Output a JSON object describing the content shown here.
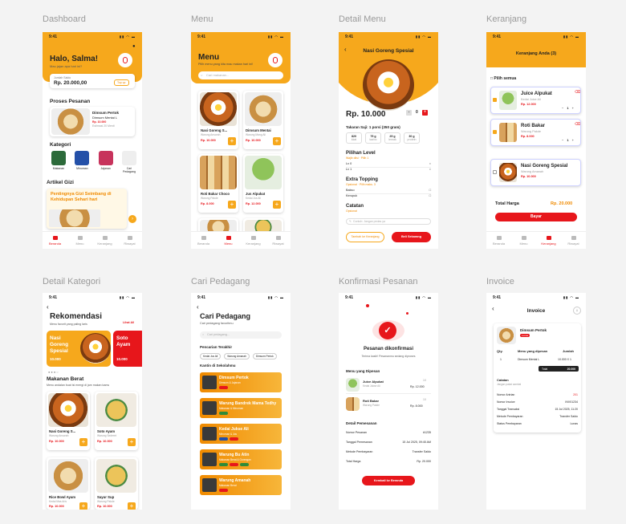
{
  "screens": {
    "dashboard": "Dashboard",
    "menu": "Menu",
    "detail_menu": "Detail Menu",
    "keranjang": "Keranjang",
    "detail_kategori": "Detail Kategori",
    "cari_pedagang": "Cari Pedagang",
    "konfirmasi": "Konfirmasi Pesanan",
    "invoice": "Invoice"
  },
  "time": "9:41",
  "nav": [
    "Beranda",
    "Menu",
    "Keranjang",
    "Riwayat"
  ],
  "dashboard": {
    "greeting": "Halo, Salma!",
    "sub": "Mau jajan apa hari ini?",
    "saldo_label": "Jumlah Saldo",
    "saldo": "Rp. 20.000,00",
    "topup": "Top up",
    "proses_title": "Proses Pesanan",
    "order_name": "Dimsum Pertok",
    "order_shop": "Dimsum Mentai L",
    "order_price": "Rp. 10.000",
    "order_eta": "Estimasi 20 Menit",
    "kategori_title": "Kategori",
    "kategori": [
      "Makanan",
      "Minuman",
      "Jajanan",
      "Cari Pedagang"
    ],
    "artikel_title": "Artikel Gizi",
    "artikel_text": "Pentingnya Gizi Seimbang di Kehidupan Sehari hari"
  },
  "menu": {
    "title": "Menu",
    "sub": "Pilih menu yang kita mau makan hari ini!",
    "search": "Cari makanan...",
    "items": [
      {
        "name": "Nasi Goreng S...",
        "shop": "Warung Ansorah",
        "price": "Rp. 10.000"
      },
      {
        "name": "Dimsum Mentai",
        "shop": "Warung Mang Ali",
        "price": "Rp. 10.000"
      },
      {
        "name": "Roti Bakar Choco",
        "shop": "Warung Pakde",
        "price": "Rp. 8.000"
      },
      {
        "name": "Jus Alpukat",
        "shop": "Kedai Jus Ali",
        "price": "Rp. 12.000"
      }
    ]
  },
  "detail": {
    "title": "Nasi Goreng Spesial",
    "price": "Rp. 10.000",
    "qty": "0",
    "gizi_title": "Takaran Saji: 1 porsi (350 gram)",
    "gizi": [
      {
        "v": "820",
        "u": "kkal"
      },
      {
        "v": "75 g",
        "u": "karbo"
      },
      {
        "v": "25 g",
        "u": "lemak"
      },
      {
        "v": "30 g",
        "u": "protein"
      }
    ],
    "level_title": "Pilihan Level",
    "level_sub": "Wajib diisi · Pilih 1",
    "levels": [
      "Lv 0",
      "Lv 1"
    ],
    "topping_title": "Extra Topping",
    "topping_sub": "Opsional · Pilih maks. 3",
    "toppings": [
      "Bakso",
      "Kerupuk"
    ],
    "catatan_title": "Catatan",
    "catatan_sub": "Opsional",
    "catatan_ph": "Contoh: Jangan pedas ya",
    "btn_cart": "Tambah ke Keranjang",
    "btn_buy": "Beli Sekarang"
  },
  "cart": {
    "title": "Keranjang Anda (3)",
    "pilih": "Pilih semua",
    "items": [
      {
        "name": "Juice Alpukat",
        "shop": "Kedai Juice Ali",
        "price": "Rp. 12.000",
        "qty": "1"
      },
      {
        "name": "Roti Bakar",
        "shop": "Warung Pakde",
        "price": "Rp. 8.000",
        "qty": "1"
      },
      {
        "name": "Nasi Goreng Spesial",
        "shop": "Warung Amanah",
        "price": "Rp. 10.000",
        "qty": "1"
      }
    ],
    "total_label": "Total Harga",
    "total": "Rp. 20.000",
    "pay": "Bayar"
  },
  "kategori": {
    "title": "Rekomendasi",
    "sub": "Menu favorit yang paling laris",
    "lihat": "Lihat All",
    "banner1": "Nasi Goreng Spesial",
    "banner1_price": "10.000",
    "banner2": "Soto Ayam",
    "banner2_price": "10.000",
    "section": "Makanan Berat",
    "section_sub": "Menu andalan buat isi energi di jam makan kamu",
    "items": [
      {
        "name": "Nasi Goreng S...",
        "shop": "Warung Ansorah",
        "price": "Rp. 10.000"
      },
      {
        "name": "Soto Ayam",
        "shop": "Warung Sederet",
        "price": "Rp. 10.000"
      },
      {
        "name": "Rice Bowl Ayam",
        "shop": "Kedai Mas Aris",
        "price": "Rp. 10.000"
      },
      {
        "name": "Sayur Sup",
        "shop": "Warung Pakde",
        "price": "Rp. 10.000"
      }
    ]
  },
  "cari": {
    "title": "Cari Pedagang",
    "sub": "Cari pedagang favoritmu",
    "search": "Cari pedagang...",
    "recent_title": "Pencarian Terakhir",
    "recent": [
      "Kedai Jus Ali",
      "Warung Amanah",
      "Dimsum Pertok"
    ],
    "kantin_title": "Kantin di Sekolahmu",
    "shops": [
      {
        "name": "Dimsum Pertok",
        "desc": "Dimsum & Jajanan"
      },
      {
        "name": "Warung Bandrek Mama Tedhy",
        "desc": "Makanan & Minuman"
      },
      {
        "name": "Kedai Jukse Ali",
        "desc": "Minuman & Jus"
      },
      {
        "name": "Warung Bu Atin",
        "desc": "Makanan Berat & Gorengan"
      },
      {
        "name": "Warung Amanah",
        "desc": "Makanan Berat"
      }
    ]
  },
  "konfirm": {
    "title": "Pesanan dikonfirmasi",
    "sub": "Terima kasih! Pesananmu sedang diproses",
    "dipesan_title": "Menu yang Dipesan",
    "items": [
      {
        "name": "Juice Alpukat",
        "shop": "Kedai Jukse Ali",
        "qty": "1X",
        "price": "Rp. 12.000"
      },
      {
        "name": "Roti Bakar",
        "shop": "Warung Pakde",
        "qty": "1X",
        "price": "Rp. 8.000"
      }
    ],
    "detail_title": "Detail Pemesanan",
    "rows": [
      {
        "k": "Nomor Pesanan",
        "v": "#1235"
      },
      {
        "k": "Tanggal Pemesanan",
        "v": "15 Jul 2025, 09:45 AM"
      },
      {
        "k": "Metode Pembayaran",
        "v": "Transfer Saldo"
      },
      {
        "k": "Total Harga",
        "v": "Rp. 20.000"
      }
    ],
    "btn": "Kembali ke Beranda"
  },
  "invoice": {
    "title": "Invoice",
    "item_name": "Dimsum Pertok",
    "badge": "Lunas",
    "h_qty": "Qty.",
    "h_menu": "Menu yang dipesan",
    "h_jumlah": "Jumlah",
    "row_qty": "1",
    "row_menu": "Dimsum Mentai L",
    "row_jumlah": "10.000 X 1",
    "total_label": "Total",
    "total": "20.000",
    "catatan": "Catatan",
    "catatan_sub": "Jangan pakai sambal",
    "rows": [
      {
        "k": "Nomor Antrian",
        "v": "201"
      },
      {
        "k": "Nomor Invoice",
        "v": "INV01234"
      },
      {
        "k": "Tanggal Transaksi",
        "v": "15 Jul 2025, 11:20"
      },
      {
        "k": "Metode Pembayaran",
        "v": "Transfer Saldo"
      },
      {
        "k": "Status Pembayaran",
        "v": "Lunas"
      }
    ]
  },
  "colors": {
    "orange": "#f6a81c",
    "red": "#e7161b",
    "bg": "#f3f3f3"
  }
}
